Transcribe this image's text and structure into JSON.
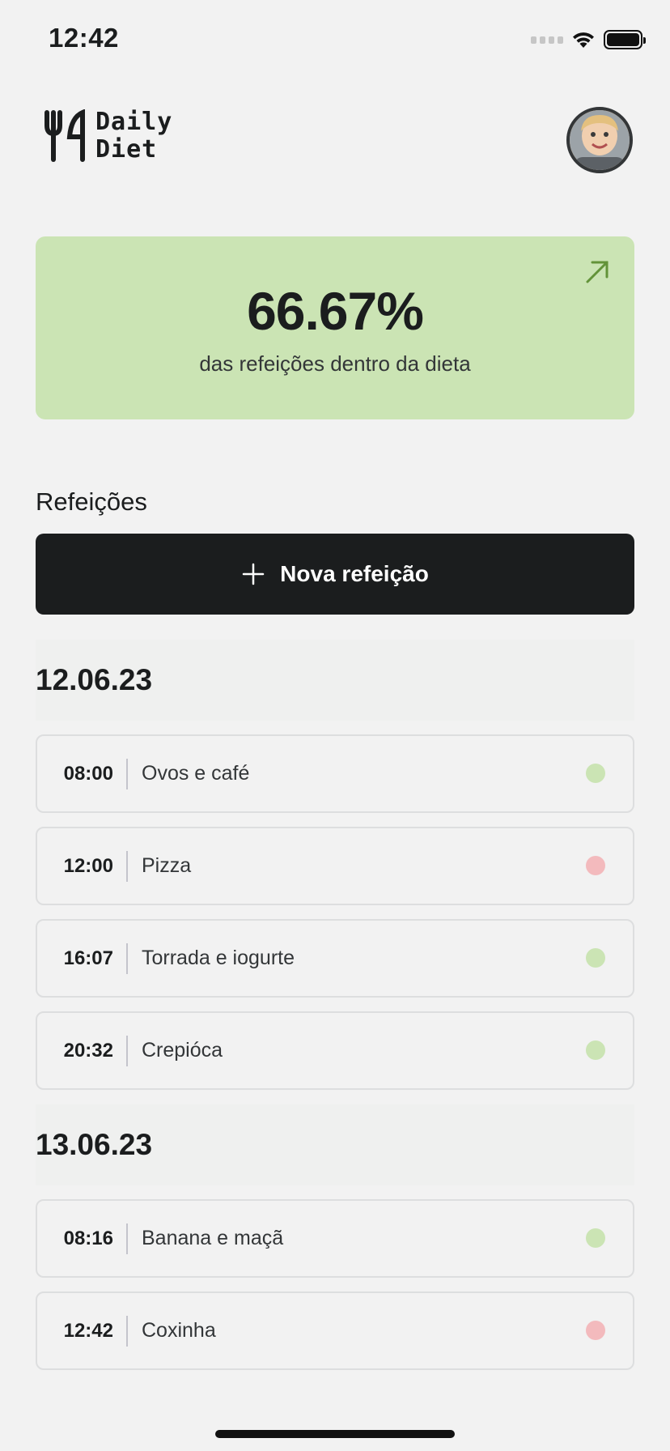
{
  "status_bar": {
    "time": "12:42"
  },
  "header": {
    "logo_line1": "Daily",
    "logo_line2": "Diet",
    "avatar_icon": "user-avatar"
  },
  "stats": {
    "percent": "66.67%",
    "description": "das refeições dentro da dieta",
    "arrow_icon": "arrow-up-right-icon",
    "color": "#CBE4B4"
  },
  "meals_section": {
    "title": "Refeições",
    "new_button_label": "Nova refeição"
  },
  "colors": {
    "in_diet": "#CBE4B4",
    "off_diet": "#F3BABD",
    "dark": "#1B1D1E"
  },
  "days": [
    {
      "date": "12.06.23",
      "meals": [
        {
          "time": "08:00",
          "name": "Ovos e café",
          "in_diet": true
        },
        {
          "time": "12:00",
          "name": "Pizza",
          "in_diet": false
        },
        {
          "time": "16:07",
          "name": "Torrada e iogurte",
          "in_diet": true
        },
        {
          "time": "20:32",
          "name": "Crepióca",
          "in_diet": true
        }
      ]
    },
    {
      "date": "13.06.23",
      "meals": [
        {
          "time": "08:16",
          "name": "Banana e maçã",
          "in_diet": true
        },
        {
          "time": "12:42",
          "name": "Coxinha",
          "in_diet": false
        }
      ]
    }
  ]
}
